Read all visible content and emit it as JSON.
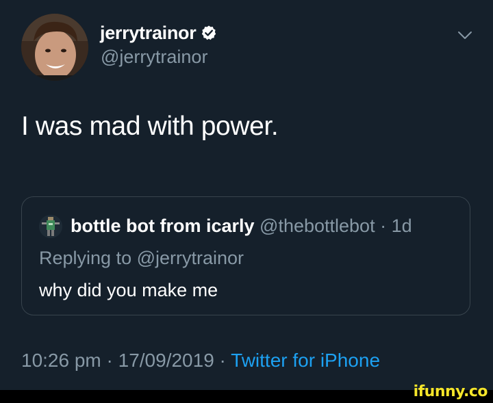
{
  "tweet": {
    "display_name": "jerrytrainor",
    "handle": "@jerrytrainor",
    "verified_icon": "verified-badge-icon",
    "menu_icon": "chevron-down-icon",
    "text": "I was mad with power.",
    "quoted": {
      "display_name": "bottle bot from icarly",
      "meta": "@thebottlebot · 1d",
      "replying_to": "Replying to @jerrytrainor",
      "text": "why did you make me"
    },
    "footer": {
      "datetime": "10:26 pm · 17/09/2019 · ",
      "source": "Twitter for iPhone"
    }
  },
  "watermark": "ifunny.co",
  "colors": {
    "background": "#15202b",
    "secondary_text": "#8899a6",
    "link": "#1da1f2",
    "border": "#38444d",
    "watermark": "#f5e52a"
  }
}
